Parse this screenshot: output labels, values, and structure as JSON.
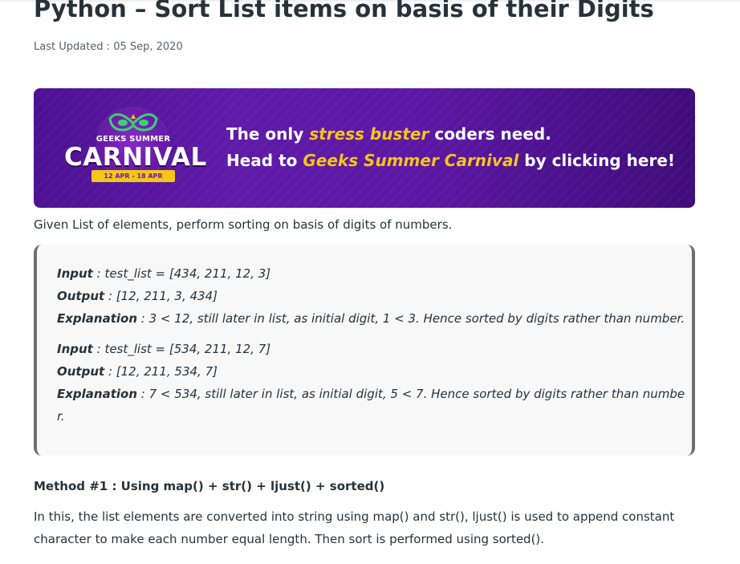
{
  "article": {
    "title": "Python – Sort List items on basis of their Digits",
    "last_updated": "Last Updated : 05 Sep, 2020"
  },
  "banner": {
    "logo_top": "GEEKS SUMMER",
    "logo_main": "CARNIVAL",
    "logo_dates": "12 APR - 18 APR",
    "line1_pre": "The only ",
    "line1_highlight": "stress buster",
    "line1_post": " coders need.",
    "line2_pre": "Head to ",
    "line2_highlight": "Geeks Summer Carnival",
    "line2_post": " by clicking here!",
    "colors": {
      "bg": "#5b17a3",
      "highlight": "#f5c518"
    }
  },
  "intro": "Given List of elements, perform sorting on basis of digits of numbers.",
  "examples": [
    {
      "input_label": "Input",
      "input": " : test_list = [434, 211, 12, 3]",
      "output_label": "Output",
      "output": " : [12, 211, 3, 434]",
      "explanation_label": "Explanation",
      "explanation": " : 3 < 12, still later in list, as initial digit, 1 < 3. Hence sorted by digits rather than number."
    },
    {
      "input_label": "Input",
      "input": " : test_list = [534, 211, 12, 7]",
      "output_label": "Output",
      "output": " : [12, 211, 534, 7]",
      "explanation_label": "Explanation",
      "explanation_line1": " : 7 < 534, still later in list, as initial digit, 5 < 7. Hence sorted by digits rather than numbe",
      "explanation_line2": "r."
    }
  ],
  "method_heading": "Method #1 : Using map() + str() + ljust() + sorted()",
  "method_text_line1": "In this, the list elements are converted into string using map() and str(), ljust() is used to append constant",
  "method_text_line2": "character to make each number equal length. Then sort is performed using sorted()."
}
